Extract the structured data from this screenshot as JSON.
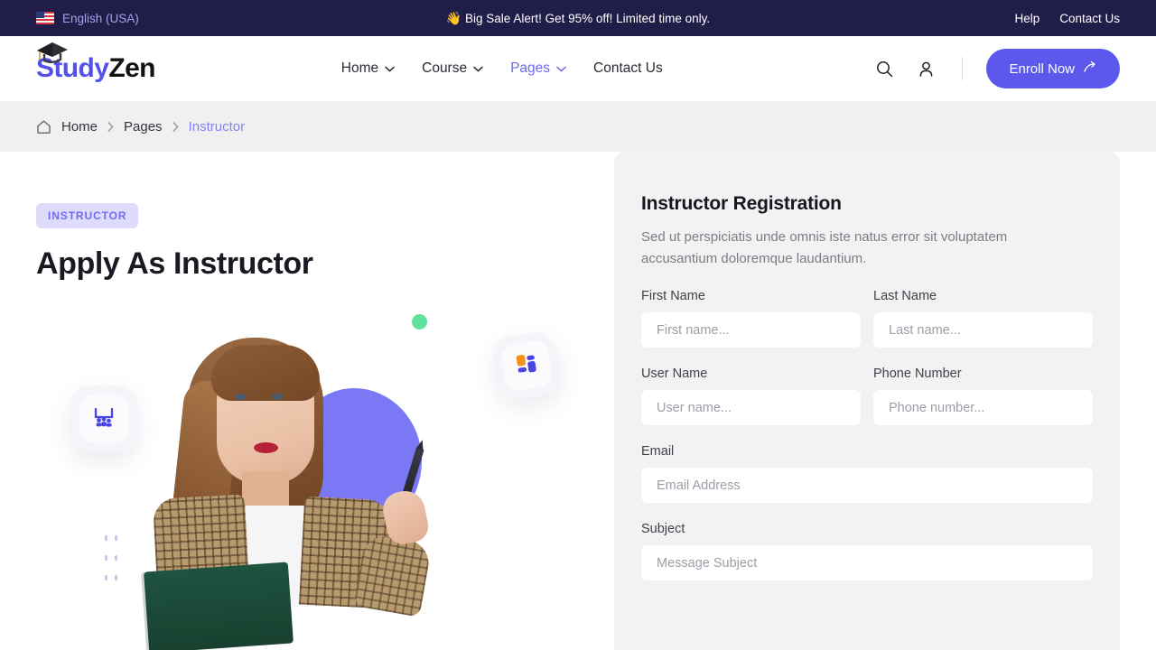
{
  "topbar": {
    "language": "English (USA)",
    "flag_icon": "us-flag-icon",
    "announcement_emoji": "👋",
    "announcement": "Big Sale Alert! Get 95% off! Limited time only.",
    "help_label": "Help",
    "contact_label": "Contact Us"
  },
  "header": {
    "logo": {
      "accent_text": "Study",
      "plain_text": "Zen",
      "icon": "graduation-cap-icon"
    },
    "nav": [
      {
        "label": "Home",
        "has_dropdown": true,
        "active": false
      },
      {
        "label": "Course",
        "has_dropdown": true,
        "active": false
      },
      {
        "label": "Pages",
        "has_dropdown": true,
        "active": true
      },
      {
        "label": "Contact Us",
        "has_dropdown": false,
        "active": false
      }
    ],
    "search_icon": "search-icon",
    "account_icon": "user-icon",
    "cta_label": "Enroll Now",
    "cta_icon": "arrow-up-right-icon",
    "cta_color": "#5b58eb"
  },
  "breadcrumb": {
    "home_icon": "home-icon",
    "items": [
      {
        "label": "Home",
        "current": false
      },
      {
        "label": "Pages",
        "current": false
      },
      {
        "label": "Instructor",
        "current": true
      }
    ],
    "separator": "›",
    "current_color": "#8582f2"
  },
  "hero": {
    "badge": "INSTRUCTOR",
    "badge_bg": "#dedcfa",
    "badge_color": "#6f6cf2",
    "title": "Apply As Instructor",
    "decor": {
      "classroom_card_icon": "classroom-presentation-icon",
      "dashboard_card_icon": "dashboard-grid-icon",
      "green_dot_color": "#5fe2a0",
      "blob_color": "#7b78f5",
      "dot_grid_color": "#c5c8e6"
    },
    "photo_alt": "instructor-photo"
  },
  "form": {
    "title": "Instructor Registration",
    "subtitle": "Sed ut perspiciatis unde omnis iste natus error sit voluptatem accusantium doloremque laudantium.",
    "rows": [
      [
        {
          "label": "First Name",
          "placeholder": "First name...",
          "value": ""
        },
        {
          "label": "Last Name",
          "placeholder": "Last name...",
          "value": ""
        }
      ],
      [
        {
          "label": "User Name",
          "placeholder": "User name...",
          "value": ""
        },
        {
          "label": "Phone Number",
          "placeholder": "Phone number...",
          "value": ""
        }
      ],
      [
        {
          "label": "Email",
          "placeholder": "Email Address",
          "value": ""
        }
      ],
      [
        {
          "label": "Subject",
          "placeholder": "Message Subject",
          "value": ""
        }
      ]
    ]
  }
}
